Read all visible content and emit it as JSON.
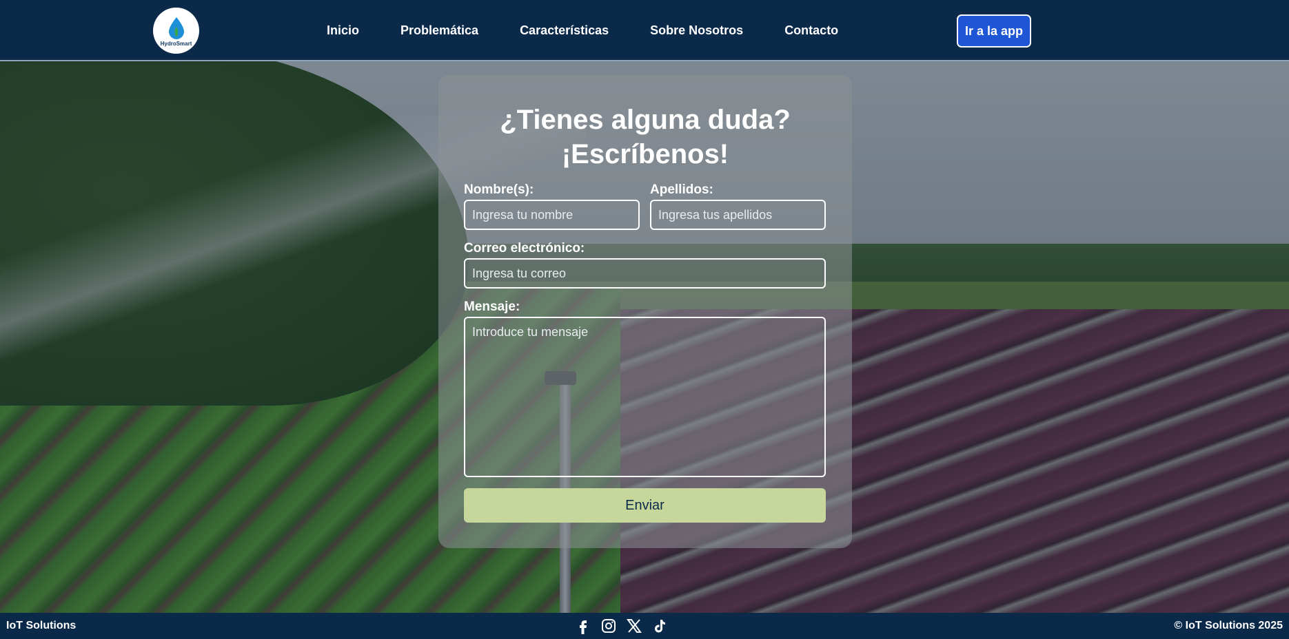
{
  "header": {
    "logo_text": "HydroSmart",
    "nav": [
      "Inicio",
      "Problemática",
      "Características",
      "Sobre Nosotros",
      "Contacto"
    ],
    "app_button": "Ir a la app"
  },
  "form": {
    "title_line1": "¿Tienes alguna duda?",
    "title_line2": "¡Escríbenos!",
    "first_name_label": "Nombre(s):",
    "first_name_placeholder": "Ingresa tu nombre",
    "last_name_label": "Apellidos:",
    "last_name_placeholder": "Ingresa tus apellidos",
    "email_label": "Correo electrónico:",
    "email_placeholder": "Ingresa tu correo",
    "message_label": "Mensaje:",
    "message_placeholder": "Introduce tu mensaje",
    "submit": "Enviar"
  },
  "footer": {
    "left": "IoT Solutions",
    "right": "© IoT Solutions 2025",
    "socials": [
      "facebook-icon",
      "instagram-icon",
      "x-icon",
      "tiktok-icon"
    ]
  },
  "colors": {
    "brand_navy": "#0b2a4a",
    "app_button": "#1f56d6",
    "submit_button": "#c7d79c"
  }
}
